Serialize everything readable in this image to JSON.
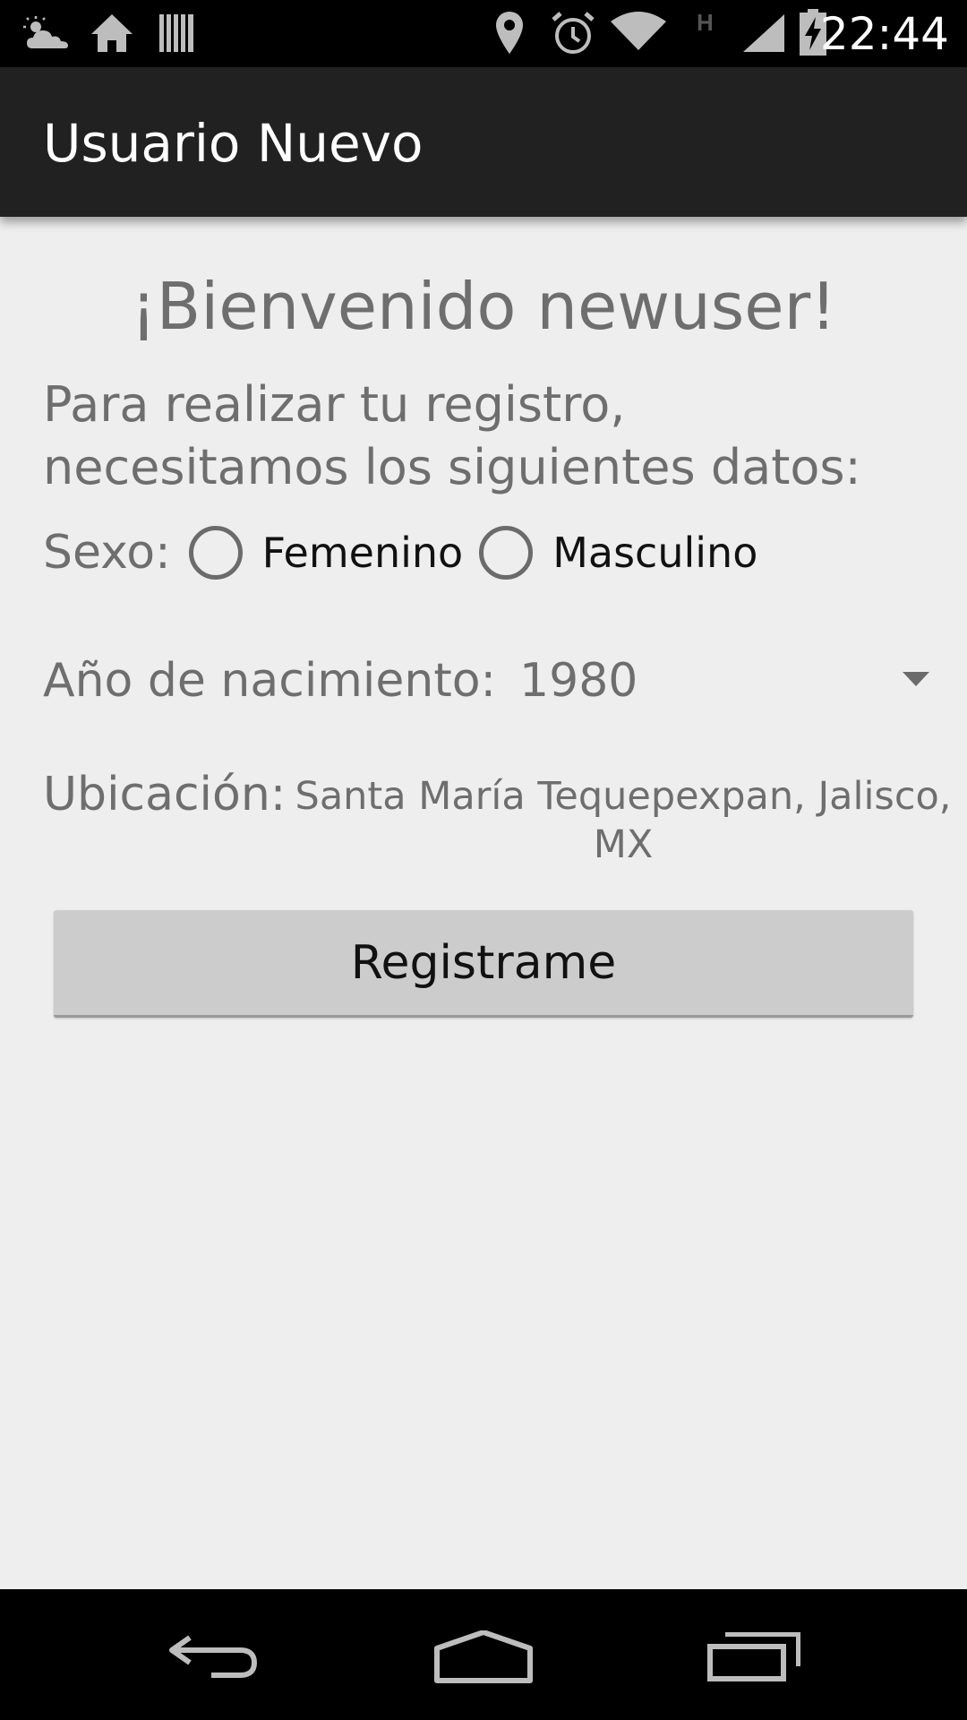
{
  "status_bar": {
    "time": "22:44",
    "left_icons": [
      "weather-icon",
      "home-icon",
      "barcode-icon"
    ],
    "right_icons": [
      "location-icon",
      "alarm-icon",
      "wifi-icon",
      "hspa-icon",
      "signal-icon",
      "battery-charging-icon"
    ],
    "network_type": "H"
  },
  "app_bar": {
    "title": "Usuario Nuevo"
  },
  "main": {
    "welcome": "¡Bienvenido newuser!",
    "intro": "Para realizar tu registro, necesitamos los siguientes datos:",
    "sex": {
      "label": "Sexo:",
      "options": [
        {
          "label": "Femenino",
          "selected": false
        },
        {
          "label": "Masculino",
          "selected": false
        }
      ]
    },
    "birth_year": {
      "label": "Año de nacimiento:",
      "value": "1980"
    },
    "location": {
      "label": "Ubicación:",
      "value": "Santa María Tequepexpan, Jalisco, MX"
    },
    "register_button": "Registrame"
  },
  "nav_bar": {
    "buttons": [
      "back-icon",
      "home-icon",
      "recent-apps-icon"
    ]
  },
  "colors": {
    "status_bar": "#000000",
    "app_bar": "#212121",
    "background": "#eeeeee",
    "button": "#cccccc",
    "secondary_text": "#6e6e6e"
  }
}
